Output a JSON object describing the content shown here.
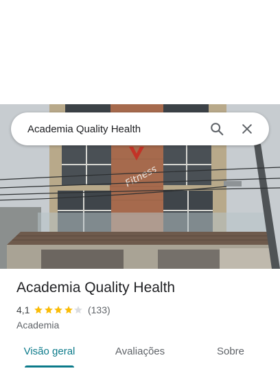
{
  "search": {
    "query": "Academia Quality Health",
    "search_icon": "search-icon",
    "close_icon": "close-icon"
  },
  "photo": {
    "sign_text": "Fitness"
  },
  "place": {
    "name": "Academia Quality Health",
    "rating": "4,1",
    "stars_filled": 4.1,
    "stars_total": 5,
    "review_count": "(133)",
    "category": "Academia"
  },
  "tabs": [
    {
      "label": "Visão geral",
      "active": true
    },
    {
      "label": "Avaliações",
      "active": false
    },
    {
      "label": "Sobre",
      "active": false
    }
  ],
  "colors": {
    "accent": "#0b7a8a",
    "star": "#fbbc04",
    "star_empty": "#dadce0"
  }
}
